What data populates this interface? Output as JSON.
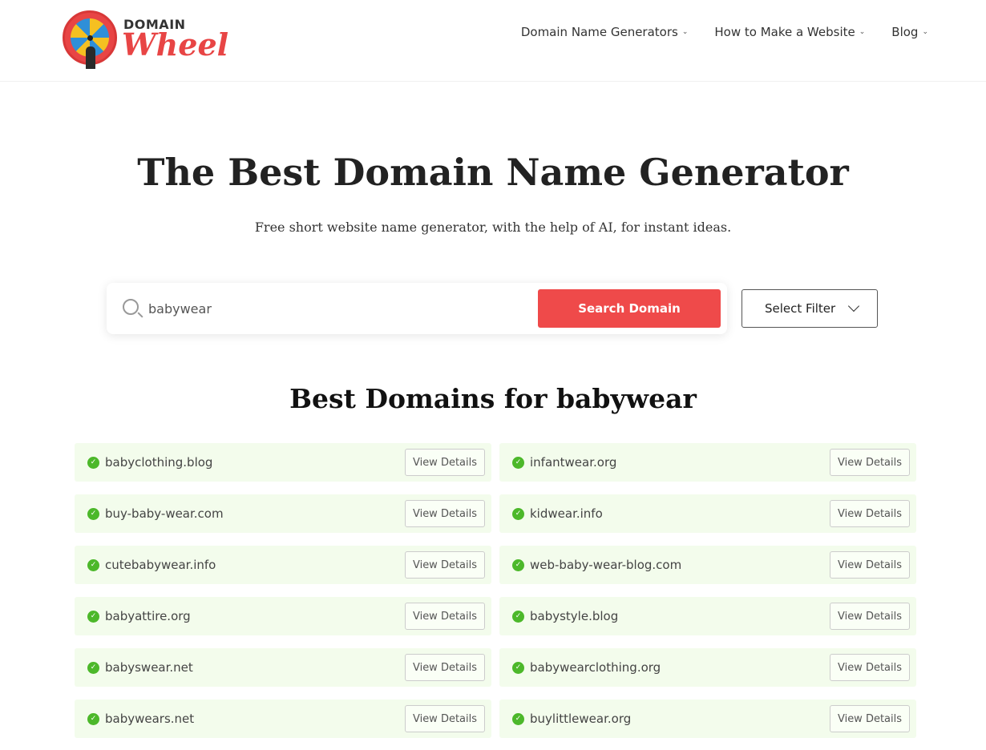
{
  "header": {
    "logo_top": "DOMAIN",
    "logo_bottom": "Wheel",
    "nav": [
      {
        "label": "Domain Name Generators"
      },
      {
        "label": "How to Make a Website"
      },
      {
        "label": "Blog"
      }
    ]
  },
  "hero": {
    "title": "The Best Domain Name Generator",
    "subtitle": "Free short website name generator, with the help of AI, for instant ideas."
  },
  "search": {
    "value": "babywear",
    "button": "Search Domain",
    "filter": "Select Filter"
  },
  "results": {
    "prefix": "Best Domains for",
    "keyword": "babywear",
    "button_label": "View Details",
    "items": [
      "babyclothing.blog",
      "infantwear.org",
      "buy-baby-wear.com",
      "kidwear.info",
      "cutebabywear.info",
      "web-baby-wear-blog.com",
      "babyattire.org",
      "babystyle.blog",
      "babyswear.net",
      "babywearclothing.org",
      "babywears.net",
      "buylittlewear.org"
    ]
  },
  "colors": {
    "accent": "#ef4a4a",
    "available": "#4cb82a",
    "row_bg": "#f3fcec"
  }
}
